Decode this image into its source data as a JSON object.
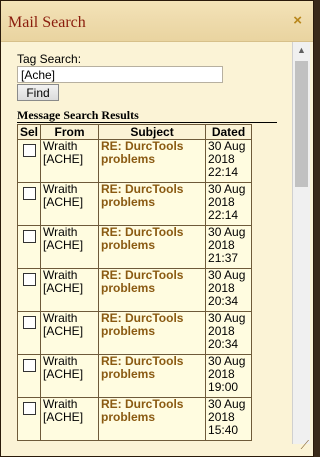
{
  "window": {
    "title": "Mail Search",
    "close_icon": "×"
  },
  "search": {
    "label": "Tag Search:",
    "value": "[Ache]",
    "button": "Find"
  },
  "results": {
    "title": "Message Search Results",
    "columns": [
      "Sel",
      "From",
      "Subject",
      "Dated"
    ],
    "rows": [
      {
        "from": "Wraith [ACHE]",
        "subject": "RE: DurcTools problems",
        "dated": "30 Aug 2018 22:14"
      },
      {
        "from": "Wraith [ACHE]",
        "subject": "RE: DurcTools problems",
        "dated": "30 Aug 2018 22:14"
      },
      {
        "from": "Wraith [ACHE]",
        "subject": "RE: DurcTools problems",
        "dated": "30 Aug 2018 21:37"
      },
      {
        "from": "Wraith [ACHE]",
        "subject": "RE: DurcTools problems",
        "dated": "30 Aug 2018 20:34"
      },
      {
        "from": "Wraith [ACHE]",
        "subject": "RE: DurcTools problems",
        "dated": "30 Aug 2018 20:34"
      },
      {
        "from": "Wraith [ACHE]",
        "subject": "RE: DurcTools problems",
        "dated": "30 Aug 2018 19:00"
      },
      {
        "from": "Wraith [ACHE]",
        "subject": "RE: DurcTools problems",
        "dated": "30 Aug 2018 15:40"
      }
    ]
  },
  "scrollbar": {
    "up_icon": "▲"
  },
  "resize_icon": "⟋"
}
